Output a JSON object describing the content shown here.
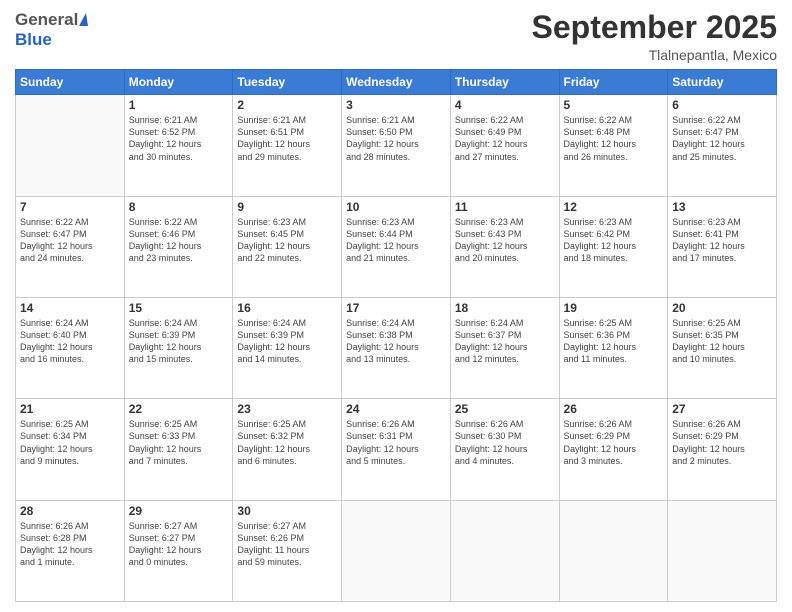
{
  "header": {
    "logo_general": "General",
    "logo_blue": "Blue",
    "month_title": "September 2025",
    "location": "Tlalnepantla, Mexico"
  },
  "days_of_week": [
    "Sunday",
    "Monday",
    "Tuesday",
    "Wednesday",
    "Thursday",
    "Friday",
    "Saturday"
  ],
  "weeks": [
    [
      {
        "day": "",
        "info": ""
      },
      {
        "day": "1",
        "info": "Sunrise: 6:21 AM\nSunset: 6:52 PM\nDaylight: 12 hours\nand 30 minutes."
      },
      {
        "day": "2",
        "info": "Sunrise: 6:21 AM\nSunset: 6:51 PM\nDaylight: 12 hours\nand 29 minutes."
      },
      {
        "day": "3",
        "info": "Sunrise: 6:21 AM\nSunset: 6:50 PM\nDaylight: 12 hours\nand 28 minutes."
      },
      {
        "day": "4",
        "info": "Sunrise: 6:22 AM\nSunset: 6:49 PM\nDaylight: 12 hours\nand 27 minutes."
      },
      {
        "day": "5",
        "info": "Sunrise: 6:22 AM\nSunset: 6:48 PM\nDaylight: 12 hours\nand 26 minutes."
      },
      {
        "day": "6",
        "info": "Sunrise: 6:22 AM\nSunset: 6:47 PM\nDaylight: 12 hours\nand 25 minutes."
      }
    ],
    [
      {
        "day": "7",
        "info": "Sunrise: 6:22 AM\nSunset: 6:47 PM\nDaylight: 12 hours\nand 24 minutes."
      },
      {
        "day": "8",
        "info": "Sunrise: 6:22 AM\nSunset: 6:46 PM\nDaylight: 12 hours\nand 23 minutes."
      },
      {
        "day": "9",
        "info": "Sunrise: 6:23 AM\nSunset: 6:45 PM\nDaylight: 12 hours\nand 22 minutes."
      },
      {
        "day": "10",
        "info": "Sunrise: 6:23 AM\nSunset: 6:44 PM\nDaylight: 12 hours\nand 21 minutes."
      },
      {
        "day": "11",
        "info": "Sunrise: 6:23 AM\nSunset: 6:43 PM\nDaylight: 12 hours\nand 20 minutes."
      },
      {
        "day": "12",
        "info": "Sunrise: 6:23 AM\nSunset: 6:42 PM\nDaylight: 12 hours\nand 18 minutes."
      },
      {
        "day": "13",
        "info": "Sunrise: 6:23 AM\nSunset: 6:41 PM\nDaylight: 12 hours\nand 17 minutes."
      }
    ],
    [
      {
        "day": "14",
        "info": "Sunrise: 6:24 AM\nSunset: 6:40 PM\nDaylight: 12 hours\nand 16 minutes."
      },
      {
        "day": "15",
        "info": "Sunrise: 6:24 AM\nSunset: 6:39 PM\nDaylight: 12 hours\nand 15 minutes."
      },
      {
        "day": "16",
        "info": "Sunrise: 6:24 AM\nSunset: 6:39 PM\nDaylight: 12 hours\nand 14 minutes."
      },
      {
        "day": "17",
        "info": "Sunrise: 6:24 AM\nSunset: 6:38 PM\nDaylight: 12 hours\nand 13 minutes."
      },
      {
        "day": "18",
        "info": "Sunrise: 6:24 AM\nSunset: 6:37 PM\nDaylight: 12 hours\nand 12 minutes."
      },
      {
        "day": "19",
        "info": "Sunrise: 6:25 AM\nSunset: 6:36 PM\nDaylight: 12 hours\nand 11 minutes."
      },
      {
        "day": "20",
        "info": "Sunrise: 6:25 AM\nSunset: 6:35 PM\nDaylight: 12 hours\nand 10 minutes."
      }
    ],
    [
      {
        "day": "21",
        "info": "Sunrise: 6:25 AM\nSunset: 6:34 PM\nDaylight: 12 hours\nand 9 minutes."
      },
      {
        "day": "22",
        "info": "Sunrise: 6:25 AM\nSunset: 6:33 PM\nDaylight: 12 hours\nand 7 minutes."
      },
      {
        "day": "23",
        "info": "Sunrise: 6:25 AM\nSunset: 6:32 PM\nDaylight: 12 hours\nand 6 minutes."
      },
      {
        "day": "24",
        "info": "Sunrise: 6:26 AM\nSunset: 6:31 PM\nDaylight: 12 hours\nand 5 minutes."
      },
      {
        "day": "25",
        "info": "Sunrise: 6:26 AM\nSunset: 6:30 PM\nDaylight: 12 hours\nand 4 minutes."
      },
      {
        "day": "26",
        "info": "Sunrise: 6:26 AM\nSunset: 6:29 PM\nDaylight: 12 hours\nand 3 minutes."
      },
      {
        "day": "27",
        "info": "Sunrise: 6:26 AM\nSunset: 6:29 PM\nDaylight: 12 hours\nand 2 minutes."
      }
    ],
    [
      {
        "day": "28",
        "info": "Sunrise: 6:26 AM\nSunset: 6:28 PM\nDaylight: 12 hours\nand 1 minute."
      },
      {
        "day": "29",
        "info": "Sunrise: 6:27 AM\nSunset: 6:27 PM\nDaylight: 12 hours\nand 0 minutes."
      },
      {
        "day": "30",
        "info": "Sunrise: 6:27 AM\nSunset: 6:26 PM\nDaylight: 11 hours\nand 59 minutes."
      },
      {
        "day": "",
        "info": ""
      },
      {
        "day": "",
        "info": ""
      },
      {
        "day": "",
        "info": ""
      },
      {
        "day": "",
        "info": ""
      }
    ]
  ]
}
